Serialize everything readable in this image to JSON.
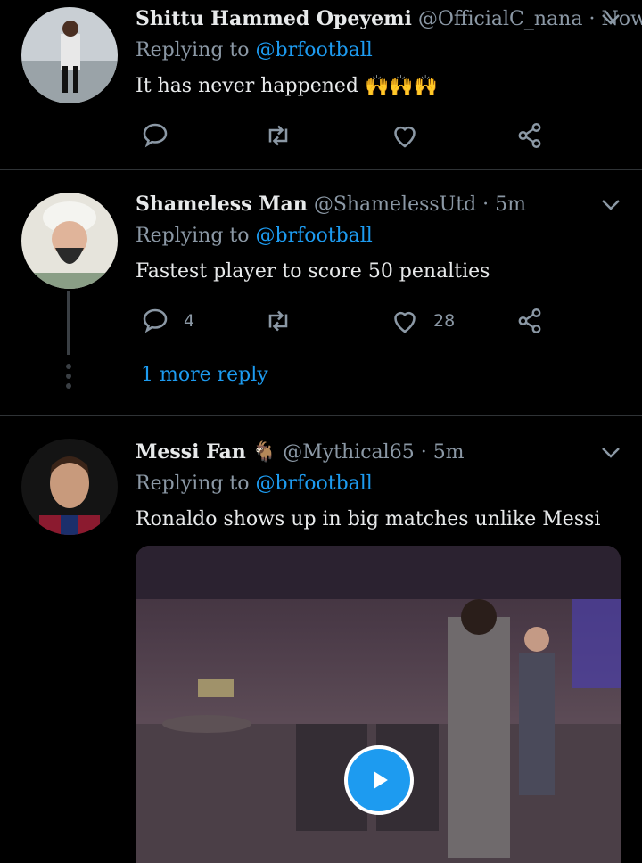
{
  "colors": {
    "background": "#000000",
    "accent": "#1d9bf0",
    "muted": "#8b98a5",
    "text": "#e7e9ea"
  },
  "tweets": [
    {
      "name": "Shittu Hammed Opeyemi",
      "handle": "@OfficialC_nana",
      "separator": "·",
      "time": "Now",
      "replying_prefix": "Replying to",
      "replying_to": "@brfootball",
      "text": "It has never happened",
      "emoji": "🙌🙌🙌",
      "reply_count": "",
      "like_count": ""
    },
    {
      "name": "Shameless Man",
      "handle": "@ShamelessUtd",
      "separator": "·",
      "time": "5m",
      "replying_prefix": "Replying to",
      "replying_to": "@brfootball",
      "text": "Fastest player to score 50 penalties",
      "reply_count": "4",
      "like_count": "28",
      "more_reply": "1 more reply"
    },
    {
      "name": "Messi Fan",
      "name_emoji": "🐐",
      "handle": "@Mythical65",
      "separator": "·",
      "time": "5m",
      "replying_prefix": "Replying to",
      "replying_to": "@brfootball",
      "text": "Ronaldo shows up in big matches unlike Messi"
    }
  ],
  "icons": [
    "reply-icon",
    "retweet-icon",
    "like-icon",
    "share-icon",
    "chevron-down-icon",
    "play-icon"
  ]
}
